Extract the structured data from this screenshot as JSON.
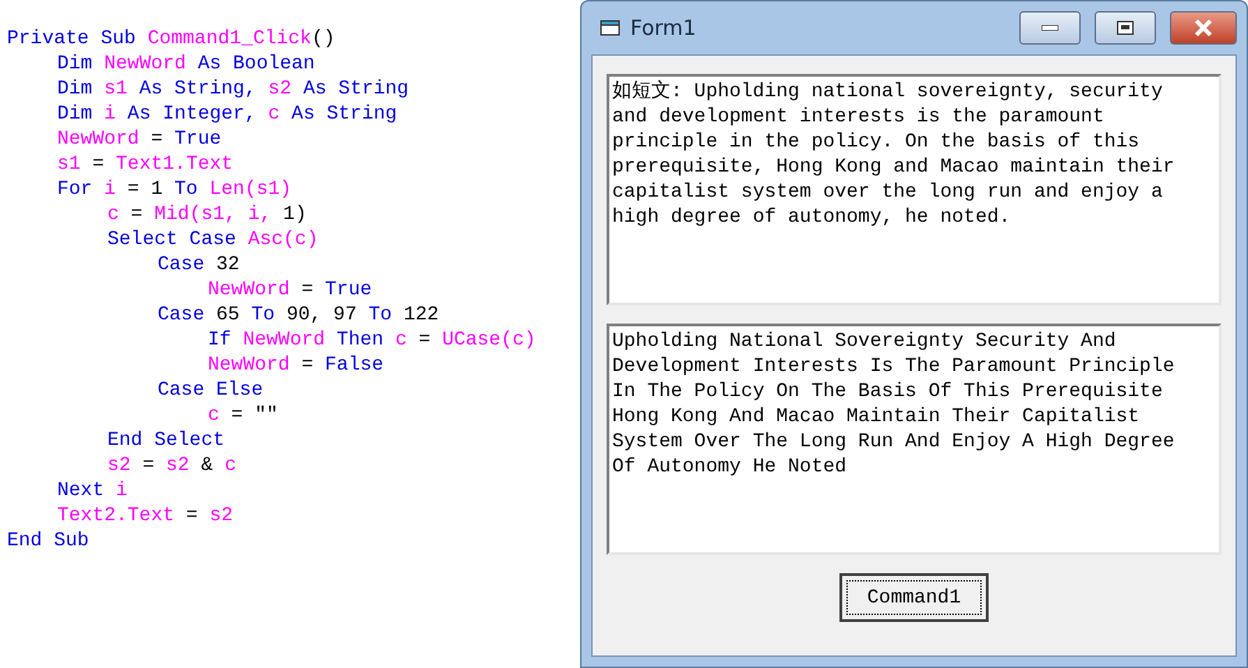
{
  "code": [
    {
      "tokens": [
        {
          "t": "Private Sub ",
          "kind": "keyword"
        },
        {
          "t": "Command1_Click",
          "kind": "ident"
        },
        {
          "t": "()",
          "kind": "plain"
        }
      ],
      "children": [
        {
          "tokens": [
            {
              "t": "Dim ",
              "kind": "keyword"
            },
            {
              "t": "NewWord",
              "kind": "ident"
            },
            {
              "t": " As Boolean",
              "kind": "keyword"
            }
          ]
        },
        {
          "tokens": [
            {
              "t": "Dim ",
              "kind": "keyword"
            },
            {
              "t": "s1",
              "kind": "ident"
            },
            {
              "t": " As String, ",
              "kind": "keyword"
            },
            {
              "t": "s2",
              "kind": "ident"
            },
            {
              "t": " As String",
              "kind": "keyword"
            }
          ]
        },
        {
          "tokens": [
            {
              "t": "Dim ",
              "kind": "keyword"
            },
            {
              "t": "i",
              "kind": "ident"
            },
            {
              "t": " As Integer, ",
              "kind": "keyword"
            },
            {
              "t": "c",
              "kind": "ident"
            },
            {
              "t": " As String",
              "kind": "keyword"
            }
          ]
        },
        {
          "tokens": [
            {
              "t": "NewWord",
              "kind": "ident"
            },
            {
              "t": " = ",
              "kind": "plain"
            },
            {
              "t": "True",
              "kind": "keyword"
            }
          ]
        },
        {
          "tokens": [
            {
              "t": "s1",
              "kind": "ident"
            },
            {
              "t": " = ",
              "kind": "plain"
            },
            {
              "t": "Text1.Text",
              "kind": "ident"
            }
          ]
        },
        {
          "tokens": [
            {
              "t": "For ",
              "kind": "keyword"
            },
            {
              "t": "i",
              "kind": "ident"
            },
            {
              "t": " = 1 ",
              "kind": "plain"
            },
            {
              "t": "To ",
              "kind": "keyword"
            },
            {
              "t": "Len(s1)",
              "kind": "ident"
            }
          ],
          "children": [
            {
              "tokens": [
                {
                  "t": "c",
                  "kind": "ident"
                },
                {
                  "t": " = ",
                  "kind": "plain"
                },
                {
                  "t": "Mid(s1, i,",
                  "kind": "ident"
                },
                {
                  "t": " 1)",
                  "kind": "plain"
                }
              ]
            },
            {
              "tokens": [
                {
                  "t": "Select Case ",
                  "kind": "keyword"
                },
                {
                  "t": "Asc(c)",
                  "kind": "ident"
                }
              ],
              "children": [
                {
                  "tokens": [
                    {
                      "t": "Case ",
                      "kind": "keyword"
                    },
                    {
                      "t": "32",
                      "kind": "plain"
                    }
                  ],
                  "children": [
                    {
                      "tokens": [
                        {
                          "t": "NewWord",
                          "kind": "ident"
                        },
                        {
                          "t": " = ",
                          "kind": "plain"
                        },
                        {
                          "t": "True",
                          "kind": "keyword"
                        }
                      ]
                    }
                  ]
                },
                {
                  "tokens": [
                    {
                      "t": "Case ",
                      "kind": "keyword"
                    },
                    {
                      "t": "65 ",
                      "kind": "plain"
                    },
                    {
                      "t": "To ",
                      "kind": "keyword"
                    },
                    {
                      "t": "90, 97 ",
                      "kind": "plain"
                    },
                    {
                      "t": "To ",
                      "kind": "keyword"
                    },
                    {
                      "t": "122",
                      "kind": "plain"
                    }
                  ],
                  "children": [
                    {
                      "tokens": [
                        {
                          "t": "If ",
                          "kind": "keyword"
                        },
                        {
                          "t": "NewWord",
                          "kind": "ident"
                        },
                        {
                          "t": " Then ",
                          "kind": "keyword"
                        },
                        {
                          "t": "c",
                          "kind": "ident"
                        },
                        {
                          "t": " = ",
                          "kind": "plain"
                        },
                        {
                          "t": "UCase(c)",
                          "kind": "ident"
                        }
                      ]
                    },
                    {
                      "tokens": [
                        {
                          "t": "NewWord",
                          "kind": "ident"
                        },
                        {
                          "t": " = ",
                          "kind": "plain"
                        },
                        {
                          "t": "False",
                          "kind": "keyword"
                        }
                      ]
                    }
                  ]
                },
                {
                  "tokens": [
                    {
                      "t": "Case Else",
                      "kind": "keyword"
                    }
                  ],
                  "children": [
                    {
                      "tokens": [
                        {
                          "t": "c",
                          "kind": "ident"
                        },
                        {
                          "t": " = \"\"",
                          "kind": "plain"
                        }
                      ]
                    }
                  ]
                }
              ]
            },
            {
              "tokens": [
                {
                  "t": "End Select",
                  "kind": "keyword"
                }
              ]
            },
            {
              "tokens": [
                {
                  "t": "s2",
                  "kind": "ident"
                },
                {
                  "t": " = ",
                  "kind": "plain"
                },
                {
                  "t": "s2",
                  "kind": "ident"
                },
                {
                  "t": " & ",
                  "kind": "plain"
                },
                {
                  "t": "c",
                  "kind": "ident"
                }
              ]
            }
          ]
        },
        {
          "tokens": [
            {
              "t": "Next ",
              "kind": "keyword"
            },
            {
              "t": "i",
              "kind": "ident"
            }
          ]
        },
        {
          "tokens": [
            {
              "t": "Text2.Text",
              "kind": "ident"
            },
            {
              "t": " = ",
              "kind": "plain"
            },
            {
              "t": "s2",
              "kind": "ident"
            }
          ]
        }
      ]
    },
    {
      "tokens": [
        {
          "t": "End Sub",
          "kind": "keyword"
        }
      ]
    }
  ],
  "window": {
    "title": "Form1"
  },
  "text1": {
    "value": "如短文: Upholding national sovereignty, security and development interests is the paramount principle in the policy. On the basis of this prerequisite, Hong Kong and Macao maintain their capitalist system over the long run and enjoy a high degree of autonomy, he noted."
  },
  "text2": {
    "value": "Upholding National Sovereignty Security And Development Interests Is The Paramount Principle In The Policy On The Basis Of This Prerequisite Hong Kong And Macao Maintain Their Capitalist System Over The Long Run And Enjoy A High Degree Of Autonomy He Noted"
  },
  "button": {
    "label": "Command1"
  }
}
